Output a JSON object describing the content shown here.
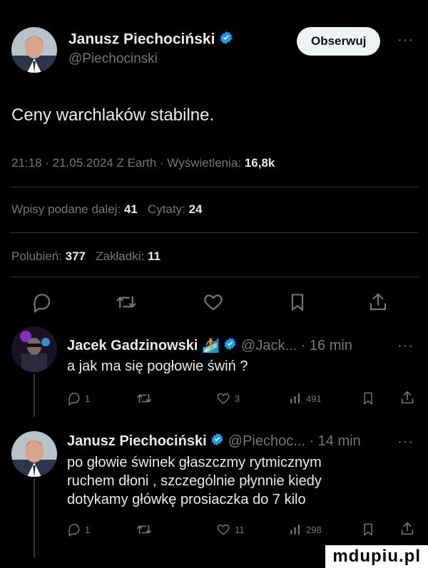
{
  "main_tweet": {
    "author_name": "Janusz Piechociński",
    "handle": "@Piechocinski",
    "follow_label": "Obserwuj",
    "more": "···",
    "text": "Ceny warchlaków stabilne.",
    "time": "21:18 · 21.05.2024 Z Earth · Wyświetlenia:",
    "views": "16,8k",
    "reposts_label": "Wpisy podane dalej:",
    "reposts": "41",
    "quotes_label": "Cytaty:",
    "quotes": "24",
    "likes_label": "Polubień:",
    "likes": "377",
    "bookmarks_label": "Zakładki:",
    "bookmarks": "11"
  },
  "replies": [
    {
      "author_name": "Jacek Gadzinowski",
      "emoji": "🏄",
      "handle_time": "@Jack... · 16 min",
      "more": "···",
      "text": "a jak ma się pogłowie świń ?",
      "reply_count": "1",
      "like_count": "3",
      "view_count": "491"
    },
    {
      "author_name": "Janusz Piechociński",
      "handle_time": "@Piechoc... · 14 min",
      "more": "···",
      "text_lines": [
        "po głowie świnek głaszczmy rytmicznym",
        "ruchem dłoni , szczególnie płynnie kiedy",
        "dotykamy główkę prosiaczka do 7 kilo"
      ],
      "reply_count": "1",
      "like_count": "11",
      "view_count": "298"
    }
  ],
  "watermark": "mdupiu.pl",
  "colors": {
    "background": "#000000",
    "text": "#e7e9ea",
    "muted": "#71767b",
    "verified": "#1d9bf0",
    "divider": "#2f3336"
  }
}
